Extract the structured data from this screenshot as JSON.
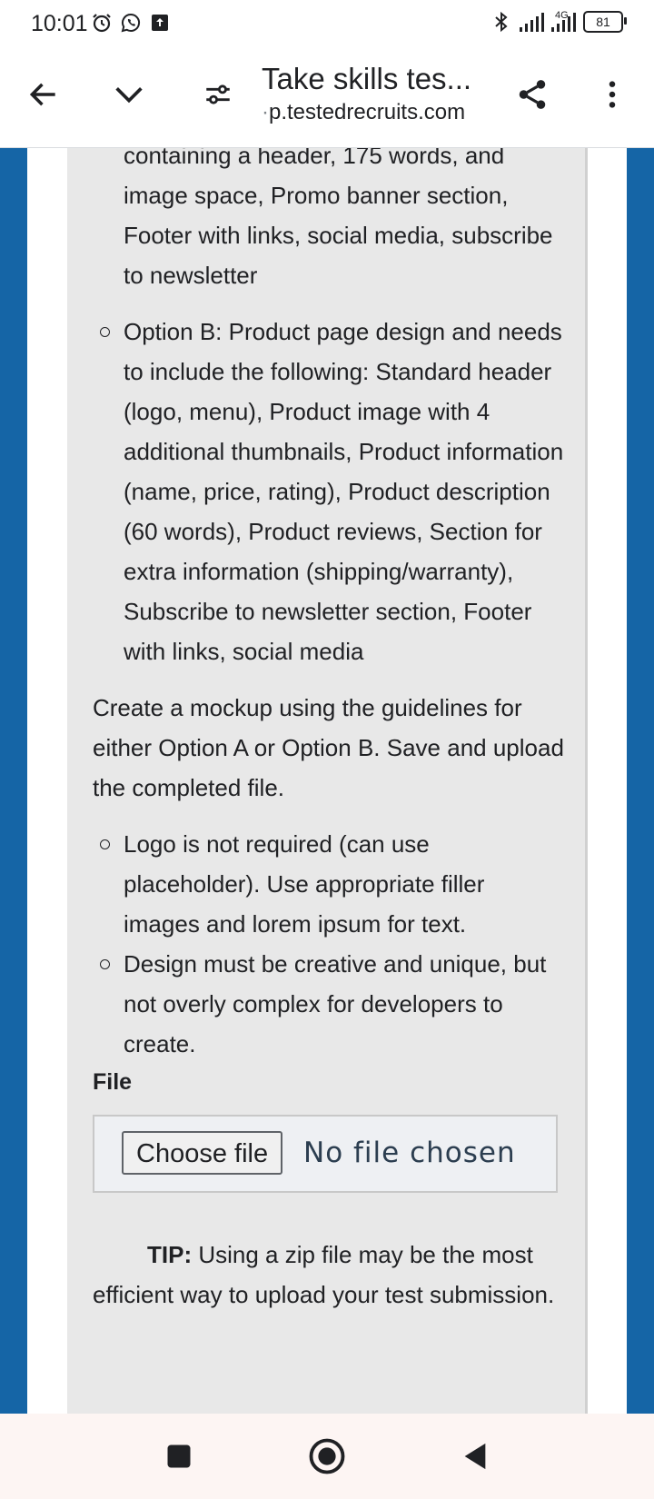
{
  "status_bar": {
    "time": "10:01",
    "network": "4G",
    "battery": "81",
    "icons": [
      "alarm-icon",
      "whatsapp-icon",
      "upload-icon",
      "bluetooth-icon",
      "signal-icon",
      "signal-4g-icon",
      "battery-icon"
    ]
  },
  "toolbar": {
    "title": "Take skills tes...",
    "url_prefix": "p.testedrecruits.com",
    "buttons": [
      "back-icon",
      "chevron-down-icon",
      "page-info-icon",
      "share-icon",
      "more-icon"
    ]
  },
  "content": {
    "option_a_tail": "containing a header, 175 words, and image space, Promo banner section, Footer with links, social media, subscribe to newsletter",
    "option_b": "Option B: Product page design and needs to include the following: Standard header (logo, menu), Product image with 4 additional thumbnails, Product information (name, price, rating), Product description (60 words), Product reviews, Section for extra information (shipping/warranty), Subscribe to newsletter section, Footer with links, social media",
    "instructions": "Create a mockup using the guidelines for either Option A or Option B. Save and upload the completed file.",
    "notes": [
      "Logo is not required (can use placeholder). Use appropriate filler images and lorem ipsum for text.",
      "Design must be creative and unique, but not overly complex for developers to create."
    ],
    "file_label": "File",
    "choose_file": "Choose file",
    "no_file": "No file chosen",
    "tip_label": "TIP:",
    "tip_text": " Using a zip file may be the most efficient way to upload your test submission."
  },
  "colors": {
    "page_bg": "#1565a6",
    "card_bg": "#e8e8e8",
    "file_box_bg": "#eef0f3",
    "nav_bg": "#fdf5f3"
  }
}
